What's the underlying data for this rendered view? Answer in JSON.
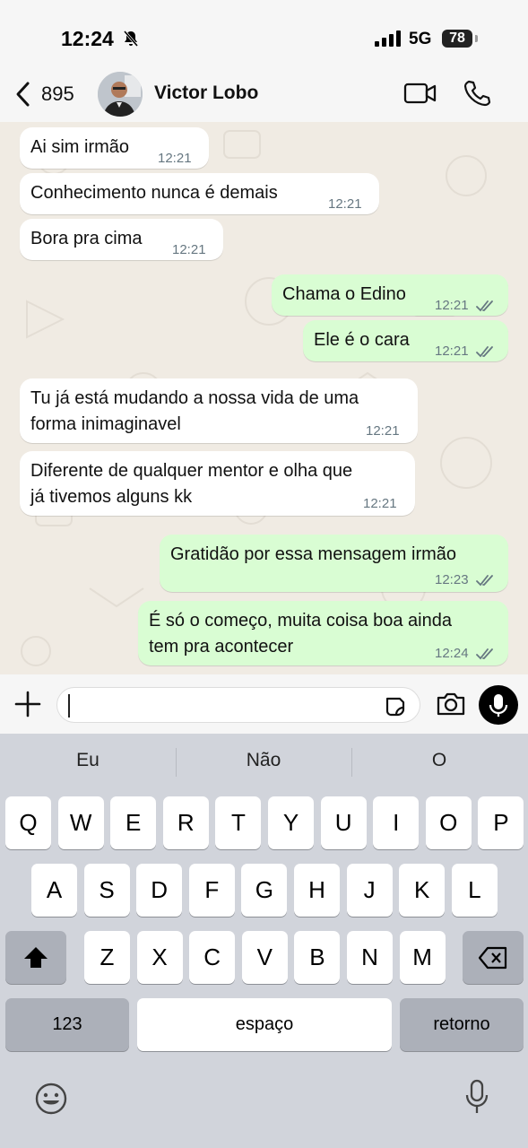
{
  "status": {
    "time": "12:24",
    "network": "5G",
    "battery": "78"
  },
  "header": {
    "back_count": "895",
    "contact_name": "Victor Lobo"
  },
  "messages": [
    {
      "dir": "in",
      "lines": [
        "Ai sim irmão"
      ],
      "time": "12:21"
    },
    {
      "dir": "in",
      "lines": [
        "Conhecimento nunca é demais"
      ],
      "time": "12:21"
    },
    {
      "dir": "in",
      "lines": [
        "Bora pra cima"
      ],
      "time": "12:21"
    },
    {
      "dir": "out",
      "lines": [
        "Chama o Edino"
      ],
      "time": "12:21",
      "read": true
    },
    {
      "dir": "out",
      "lines": [
        "Ele é o cara"
      ],
      "time": "12:21",
      "read": true
    },
    {
      "dir": "in",
      "lines": [
        "Tu já está mudando a nossa vida de uma",
        "forma inimaginavel"
      ],
      "time": "12:21"
    },
    {
      "dir": "in",
      "lines": [
        "Diferente de qualquer mentor e olha que",
        "já tivemos alguns kk"
      ],
      "time": "12:21"
    },
    {
      "dir": "out",
      "lines": [
        "Gratidão por essa mensagem irmão"
      ],
      "time": "12:23",
      "read": true
    },
    {
      "dir": "out",
      "lines": [
        "É só o começo, muita coisa boa ainda",
        "tem pra acontecer"
      ],
      "time": "12:24",
      "read": true
    }
  ],
  "input": {
    "value": ""
  },
  "keyboard": {
    "suggestions": [
      "Eu",
      "Não",
      "O"
    ],
    "row1": [
      "Q",
      "W",
      "E",
      "R",
      "T",
      "Y",
      "U",
      "I",
      "O",
      "P"
    ],
    "row2": [
      "A",
      "S",
      "D",
      "F",
      "G",
      "H",
      "J",
      "K",
      "L"
    ],
    "row3": [
      "Z",
      "X",
      "C",
      "V",
      "B",
      "N",
      "M"
    ],
    "numbers_label": "123",
    "space_label": "espaço",
    "return_label": "retorno"
  },
  "colors": {
    "incoming": "#ffffff",
    "outgoing": "#d9fdd3",
    "read_ticks": "#667781"
  }
}
